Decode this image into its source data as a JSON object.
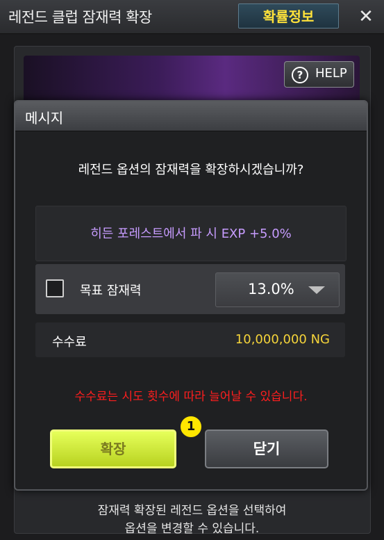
{
  "window": {
    "title": "레전드 클럽 잠재력 확장",
    "probability_button": "확률정보",
    "close_symbol": "✕"
  },
  "help": {
    "label": "HELP",
    "icon": "question-mark-icon"
  },
  "footer": {
    "line1": "잠재력 확장된 레전드 옵션을 선택하여",
    "line2": "옵션을 변경할 수 있습니다."
  },
  "dialog": {
    "title": "메시지",
    "question": "레전드 옵션의 잠재력을 확장하시겠습니까?",
    "option_text": "히든 포레스트에서 파 시 EXP +5.0%",
    "target": {
      "label": "목표 잠재력",
      "checked": false,
      "selected_value": "13.0%"
    },
    "fee": {
      "label": "수수료",
      "value": "10,000,000 NG"
    },
    "warning": "수수료는 시도 횟수에 따라 늘어날 수 있습니다.",
    "badge": "1",
    "expand_button": "확장",
    "close_button": "닫기"
  },
  "colors": {
    "accent_yellow": "#ffe23a",
    "option_purple": "#c79cff",
    "warning_red": "#ff1e1e",
    "expand_green": "#d0ec3a"
  }
}
